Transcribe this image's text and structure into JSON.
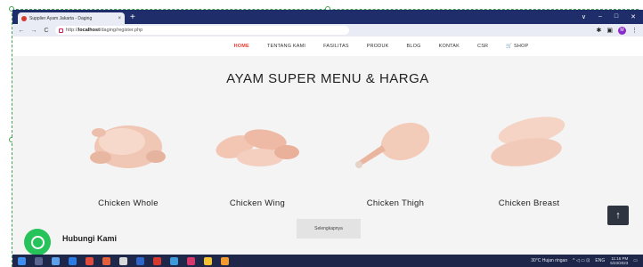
{
  "browser": {
    "tab_title": "Supplier Ayam Jakarta - Daging",
    "tab_close": "×",
    "new_tab": "+",
    "url_prefix": "http://",
    "url_host": "localhost",
    "url_path": "/daging/register.php",
    "window_controls": [
      "∨",
      "–",
      "□",
      "✕"
    ],
    "profile_initial": "M"
  },
  "nav": {
    "items": [
      {
        "label": "HOME",
        "active": true
      },
      {
        "label": "TENTANG KAMI",
        "active": false
      },
      {
        "label": "FASILITAS",
        "active": false
      },
      {
        "label": "PRODUK",
        "active": false
      },
      {
        "label": "BLOG",
        "active": false
      },
      {
        "label": "KONTAK",
        "active": false
      },
      {
        "label": "CSR",
        "active": false
      },
      {
        "label": "🛒 SHOP",
        "active": false
      }
    ]
  },
  "main": {
    "heading": "AYAM SUPER MENU & HARGA",
    "products": [
      {
        "name": "Chicken Whole",
        "icon": "whole-chicken-image"
      },
      {
        "name": "Chicken Wing",
        "icon": "chicken-wing-image"
      },
      {
        "name": "Chicken Thigh",
        "icon": "chicken-thigh-image"
      },
      {
        "name": "Chicken Breast",
        "icon": "chicken-breast-image"
      }
    ],
    "more_button": "Selengkapnya"
  },
  "floating": {
    "contact_label": "Hubungi Kami",
    "scroll_top": "↑"
  },
  "taskbar": {
    "weather": "30°C  Hujan ringan",
    "lang": "ENG",
    "time": "11:16 PM",
    "date": "5/23/2023"
  },
  "colors": {
    "accent": "#e43d30",
    "whatsapp": "#25c35a",
    "titlebar": "#1f2d6b",
    "taskbar": "#1e2749"
  }
}
